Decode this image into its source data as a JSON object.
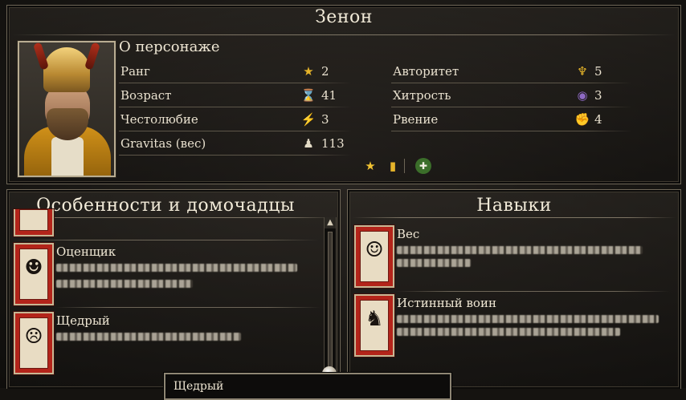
{
  "character": {
    "name": "Зенон",
    "about_heading": "О персонаже"
  },
  "stats_left": [
    {
      "label": "Ранг",
      "icon": "star-icon",
      "glyph": "★",
      "value": "2"
    },
    {
      "label": "Возраст",
      "icon": "hourglass-icon",
      "glyph": "⌛",
      "value": "41"
    },
    {
      "label": "Честолюбие",
      "icon": "lightning-icon",
      "glyph": "⚡",
      "value": "3"
    },
    {
      "label": "Gravitas (вес)",
      "icon": "gravitas-icon",
      "glyph": "♟",
      "value": "113"
    }
  ],
  "stats_right": [
    {
      "label": "Авторитет",
      "icon": "eagle-icon",
      "glyph": "♆",
      "value": "5"
    },
    {
      "label": "Хитрость",
      "icon": "eye-icon",
      "glyph": "◉",
      "value": "3"
    },
    {
      "label": "Рвение",
      "icon": "fist-icon",
      "glyph": "✊",
      "value": "4"
    }
  ],
  "trait_icons": [
    {
      "name": "rank-star-icon",
      "glyph": "★"
    },
    {
      "name": "scroll-icon",
      "glyph": "▮"
    },
    {
      "name": "add-follower-icon",
      "glyph": "✚"
    }
  ],
  "traits_panel": {
    "title": "Особенности и домочадцы",
    "items": [
      {
        "title": "Оценщик",
        "icon": "theater-mask-icon"
      },
      {
        "title": "Щедрый",
        "icon": "demon-mask-icon"
      }
    ]
  },
  "skills_panel": {
    "title": "Навыки",
    "items": [
      {
        "title": "Вес",
        "icon": "masks-icon"
      },
      {
        "title": "Истинный воин",
        "icon": "warrior-icon"
      }
    ]
  },
  "tooltip": {
    "text": "Щедрый"
  },
  "colors": {
    "card_red": "#b3241a",
    "gold": "#e6b42a",
    "text": "#e9e1cf"
  }
}
